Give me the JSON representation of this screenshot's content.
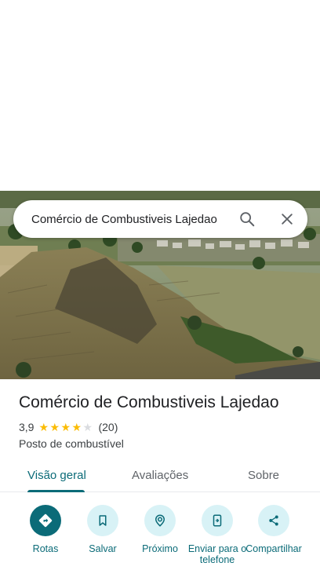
{
  "search": {
    "query": "Comércio de Combustiveis Lajedao"
  },
  "place": {
    "title": "Comércio de Combustiveis Lajedao",
    "rating": "3,9",
    "rating_stars": 3.9,
    "review_count": "(20)",
    "category": "Posto de combustível"
  },
  "tabs": [
    {
      "label": "Visão geral",
      "active": true
    },
    {
      "label": "Avaliações",
      "active": false
    },
    {
      "label": "Sobre",
      "active": false
    }
  ],
  "actions": [
    {
      "label": "Rotas",
      "icon": "directions-icon"
    },
    {
      "label": "Salvar",
      "icon": "bookmark-icon"
    },
    {
      "label": "Próximo",
      "icon": "nearby-icon"
    },
    {
      "label": "Enviar para o telefone",
      "icon": "send-to-phone-icon"
    },
    {
      "label": "Compartilhar",
      "icon": "share-icon"
    }
  ],
  "colors": {
    "accent": "#0b6b78",
    "accent_light": "#d8f2f6",
    "star": "#fbbc04"
  }
}
